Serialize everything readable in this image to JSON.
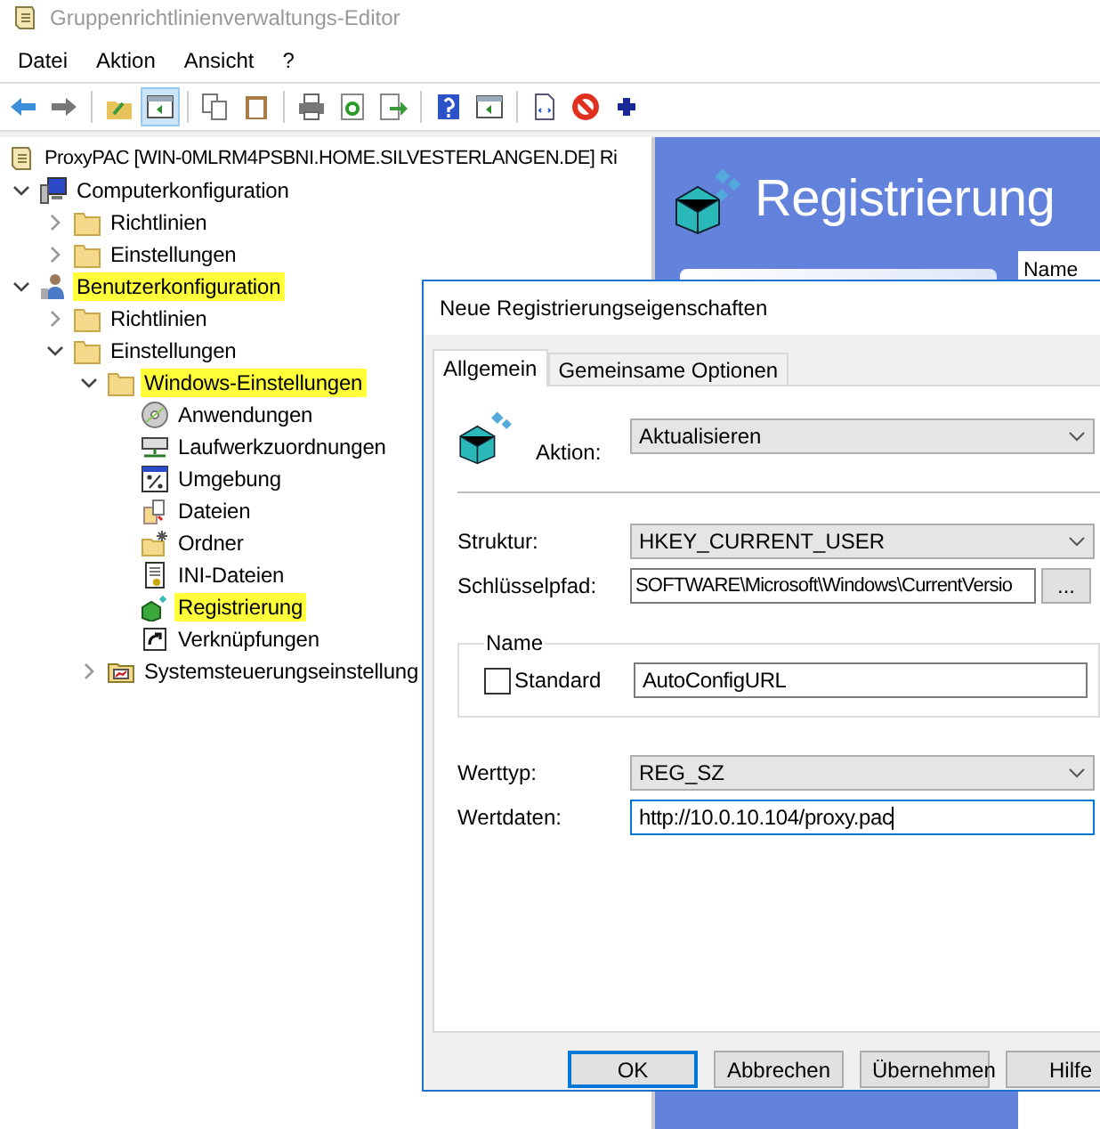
{
  "window": {
    "title": "Gruppenrichtlinienverwaltungs-Editor"
  },
  "menu": [
    "Datei",
    "Aktion",
    "Ansicht",
    "?"
  ],
  "toolbar": [
    {
      "kind": "back",
      "selected": false
    },
    {
      "kind": "forward",
      "selected": false
    },
    {
      "kind": "up",
      "selected": false
    },
    {
      "kind": "pane",
      "selected": true
    },
    {
      "kind": "copy",
      "selected": false
    },
    {
      "kind": "paste",
      "selected": false
    },
    {
      "kind": "print",
      "selected": false
    },
    {
      "kind": "refresh",
      "selected": false
    },
    {
      "kind": "export",
      "selected": false
    },
    {
      "kind": "help",
      "selected": false
    },
    {
      "kind": "pane2",
      "selected": false
    },
    {
      "kind": "xml",
      "selected": false
    },
    {
      "kind": "stop",
      "selected": false
    },
    {
      "kind": "add",
      "selected": false
    }
  ],
  "tree": {
    "label": "ProxyPAC [WIN-0MLRM4PSBNI.HOME.SILVESTERLANGEN.DE] Ri",
    "kind": "policy",
    "highlighted": false,
    "children": [
      {
        "label": "Computerkonfiguration",
        "kind": "computer",
        "expanded": true,
        "highlighted": false,
        "children": [
          {
            "label": "Richtlinien",
            "kind": "folder",
            "expanded": false,
            "highlighted": false
          },
          {
            "label": "Einstellungen",
            "kind": "folder",
            "expanded": false,
            "highlighted": false
          }
        ]
      },
      {
        "label": "Benutzerkonfiguration",
        "kind": "user",
        "expanded": true,
        "highlighted": true,
        "children": [
          {
            "label": "Richtlinien",
            "kind": "folder",
            "expanded": false,
            "highlighted": false
          },
          {
            "label": "Einstellungen",
            "kind": "folder",
            "expanded": true,
            "highlighted": false,
            "children": [
              {
                "label": "Windows-Einstellungen",
                "kind": "folder",
                "expanded": true,
                "highlighted": true,
                "children": [
                  {
                    "label": "Anwendungen",
                    "kind": "disc",
                    "highlighted": false
                  },
                  {
                    "label": "Laufwerkzuordnungen",
                    "kind": "drive",
                    "highlighted": false
                  },
                  {
                    "label": "Umgebung",
                    "kind": "env",
                    "highlighted": false
                  },
                  {
                    "label": "Dateien",
                    "kind": "files",
                    "highlighted": false
                  },
                  {
                    "label": "Ordner",
                    "kind": "newfolder",
                    "highlighted": false
                  },
                  {
                    "label": "INI-Dateien",
                    "kind": "ini",
                    "highlighted": false
                  },
                  {
                    "label": "Registrierung",
                    "kind": "registry",
                    "highlighted": true
                  },
                  {
                    "label": "Verknüpfungen",
                    "kind": "shortcut",
                    "highlighted": false
                  }
                ]
              },
              {
                "label": "Systemsteuerungseinstellung",
                "kind": "panel",
                "expanded": false,
                "highlighted": false
              }
            ]
          }
        ]
      }
    ]
  },
  "right_pane": {
    "heading": "Registrierung",
    "column_header": "Name"
  },
  "dialog": {
    "title": "Neue Registrierungseigenschaften",
    "tabs": [
      {
        "label": "Allgemein",
        "selected": true
      },
      {
        "label": "Gemeinsame Optionen",
        "selected": false
      }
    ],
    "action": {
      "label": "Aktion:",
      "value": "Aktualisieren"
    },
    "hive": {
      "label": "Struktur:",
      "value": "HKEY_CURRENT_USER"
    },
    "key_path": {
      "label": "Schlüsselpfad:",
      "value": "SOFTWARE\\Microsoft\\Windows\\CurrentVersio",
      "browse": "..."
    },
    "name_group": {
      "legend": "Name",
      "default_label": "Standard",
      "default_checked": false,
      "value": "AutoConfigURL"
    },
    "value_type": {
      "label": "Werttyp:",
      "value": "REG_SZ"
    },
    "value_data": {
      "label": "Wertdaten:",
      "value": "http://10.0.10.104/proxy.pac",
      "focused": true
    },
    "buttons": [
      {
        "label": "OK",
        "default": true
      },
      {
        "label": "Abbrechen",
        "default": false
      },
      {
        "label": "Übernehmen",
        "default": false
      },
      {
        "label": "Hilfe",
        "default": false
      }
    ]
  }
}
